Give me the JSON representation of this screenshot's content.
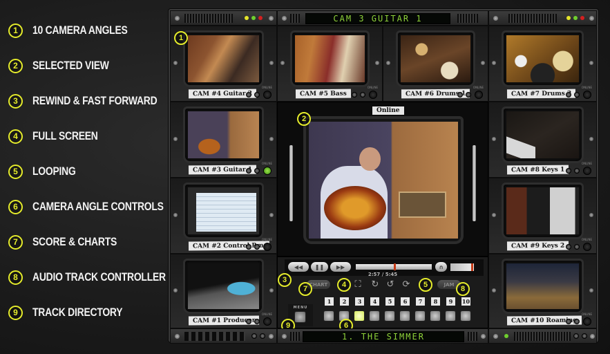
{
  "legend": [
    {
      "num": "1",
      "label": "10 Camera Angles"
    },
    {
      "num": "2",
      "label": "Selected View"
    },
    {
      "num": "3",
      "label": "Rewind & Fast Forward"
    },
    {
      "num": "4",
      "label": "Full Screen"
    },
    {
      "num": "5",
      "label": "Looping"
    },
    {
      "num": "6",
      "label": "Camera Angle Controls"
    },
    {
      "num": "7",
      "label": "Score & Charts"
    },
    {
      "num": "8",
      "label": "Audio Track Controller"
    },
    {
      "num": "9",
      "label": "Track Directory"
    }
  ],
  "header": {
    "display": "CAM 3 GUITAR 1"
  },
  "footer": {
    "display": "1. THE SIMMER"
  },
  "cameras": [
    {
      "label": "CAM #4 Guitar 2",
      "online": "ONLINE"
    },
    {
      "label": "CAM #5 Bass",
      "online": "ONLINE"
    },
    {
      "label": "CAM #6 Drums 1",
      "online": "ONLINE"
    },
    {
      "label": "CAM #7 Drums 2",
      "online": "ONLINE"
    },
    {
      "label": "CAM #3 Guitar 1",
      "online": "ONLINE"
    },
    {
      "label": "CAM #8 Keys 1",
      "online": "ONLINE"
    },
    {
      "label": "CAM #2 Control Rm.",
      "online": "ONLINE"
    },
    {
      "label": "CAM #9 Keys 2",
      "online": "ONLINE"
    },
    {
      "label": "CAM #1 Producer",
      "online": "ONLINE"
    },
    {
      "label": "CAM #10 Roaming",
      "online": "ONLINE"
    }
  ],
  "selected_view": {
    "tag": "Online"
  },
  "player": {
    "rewind": "◀◀",
    "pause": "❚❚",
    "forward": "▶▶",
    "time": "2:57 / 5:45",
    "progress_percent": 51,
    "volume_percent": 95,
    "headphones_icon": "headphones-icon",
    "chart_label": "CHART",
    "jam_label": "JAM",
    "fullscreen_icon": "⛶",
    "loop_icons": [
      "↻",
      "↺",
      "⟳"
    ]
  },
  "angle_numbers": [
    "1",
    "2",
    "3",
    "4",
    "5",
    "6",
    "7",
    "8",
    "9",
    "10"
  ],
  "active_angle": 3,
  "menu": {
    "label": "MENU"
  },
  "colors": {
    "accent": "#e5ec2b",
    "lcd": "#8fd23a",
    "marker": "#c43a16"
  }
}
